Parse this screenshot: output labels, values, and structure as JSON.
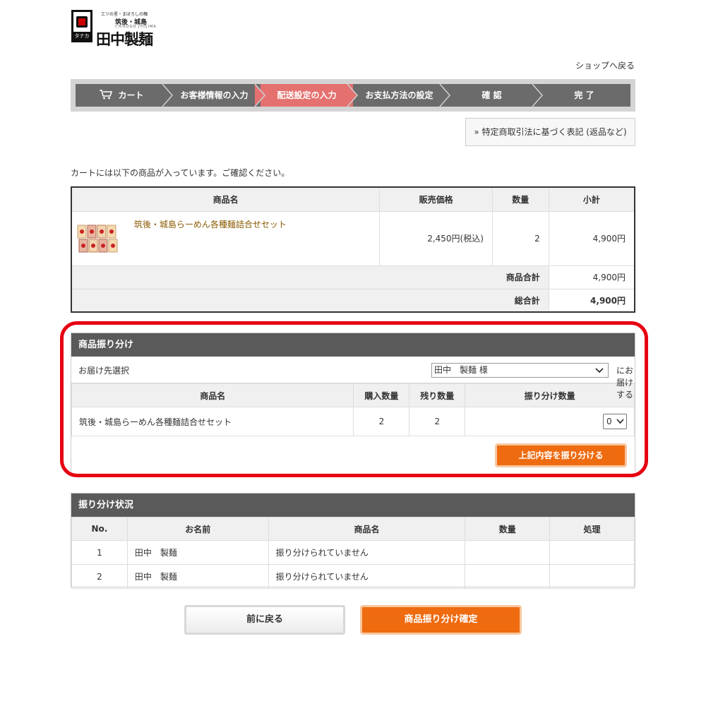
{
  "logo": {
    "kana": "タナカ",
    "tagline": "エツの里・まぼろしの麺",
    "region": "筑後・城島",
    "roman": "CHIKUGO JYOJIMA",
    "name": "田中製麺"
  },
  "header": {
    "back_to_shop": "ショップへ戻る"
  },
  "steps": [
    "カート",
    "お客様情報の入力",
    "配送設定の入力",
    "お支払方法の設定",
    "確 認",
    "完 了"
  ],
  "active_step": 2,
  "legal_link": "» 特定商取引法に基づく表記 (返品など)",
  "intro_text": "カートには以下の商品が入っています。ご確認ください。",
  "cart": {
    "headers": [
      "商品名",
      "販売価格",
      "数量",
      "小計"
    ],
    "item": {
      "name": "筑後・城島らーめん各種麺詰合せセット",
      "price": "2,450円(税込)",
      "qty": "2",
      "subtotal": "4,900円"
    },
    "goods_total_label": "商品合計",
    "goods_total": "4,900円",
    "grand_total_label": "総合計",
    "grand_total": "4,900円"
  },
  "distribution": {
    "title": "商品振り分け",
    "dest_label": "お届け先選択",
    "dest_value": "田中　製麺 様",
    "dest_suffix": "にお届けする",
    "headers": [
      "商品名",
      "購入数量",
      "残り数量",
      "振り分け数量"
    ],
    "row": {
      "name": "筑後・城島らーめん各種麺詰合せセット",
      "purchased": "2",
      "remaining": "2",
      "assign": "0"
    },
    "apply_button": "上記内容を振り分ける"
  },
  "status": {
    "title": "振り分け状況",
    "headers": [
      "No.",
      "お名前",
      "商品名",
      "数量",
      "処理"
    ],
    "rows": [
      {
        "no": "1",
        "name": "田中　製麺",
        "product": "振り分けられていません",
        "qty": "",
        "action": ""
      },
      {
        "no": "2",
        "name": "田中　製麺",
        "product": "振り分けられていません",
        "qty": "",
        "action": ""
      }
    ]
  },
  "buttons": {
    "back": "前に戻る",
    "confirm": "商品振り分け確定"
  },
  "colors": {
    "active_step": "#e4716f",
    "step_bg": "#6b6b6b",
    "accent_orange": "#ee6b10",
    "highlight_red": "#e60012",
    "panel_header": "#5a5a5a"
  }
}
